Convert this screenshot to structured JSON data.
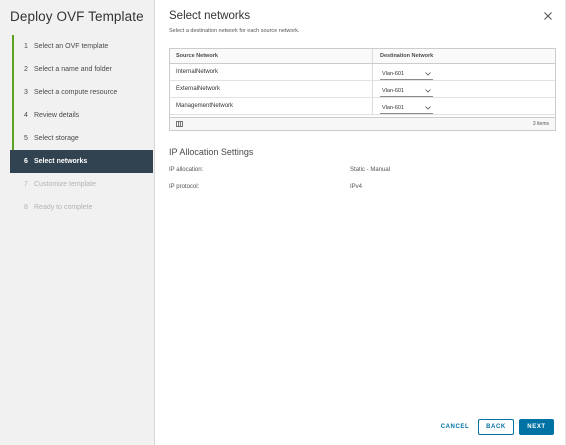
{
  "wizard": {
    "title": "Deploy OVF Template",
    "steps": [
      {
        "num": "1",
        "label": "Select an OVF template",
        "state": "done"
      },
      {
        "num": "2",
        "label": "Select a name and folder",
        "state": "done"
      },
      {
        "num": "3",
        "label": "Select a compute resource",
        "state": "done"
      },
      {
        "num": "4",
        "label": "Review details",
        "state": "done"
      },
      {
        "num": "5",
        "label": "Select storage",
        "state": "done"
      },
      {
        "num": "6",
        "label": "Select networks",
        "state": "active"
      },
      {
        "num": "7",
        "label": "Customize template",
        "state": "disabled"
      },
      {
        "num": "8",
        "label": "Ready to complete",
        "state": "disabled"
      }
    ]
  },
  "page": {
    "title": "Select networks",
    "subtitle": "Select a destination network for each source network."
  },
  "grid": {
    "headers": {
      "source": "Source Network",
      "destination": "Destination Network"
    },
    "rows": [
      {
        "source": "InternalNetwork",
        "destination": "Vlan-601"
      },
      {
        "source": "ExternalNetwork",
        "destination": "Vlan-601"
      },
      {
        "source": "ManagementNetwork",
        "destination": "Vlan-601"
      }
    ],
    "footer_count": "3 items"
  },
  "ip_settings": {
    "title": "IP Allocation Settings",
    "allocation_label": "IP allocation:",
    "allocation_value": "Static - Manual",
    "protocol_label": "IP protocol:",
    "protocol_value": "IPv4"
  },
  "buttons": {
    "cancel": "CANCEL",
    "back": "BACK",
    "next": "NEXT"
  },
  "colors": {
    "accent": "#0072a3",
    "completed_step": "#5aa220",
    "active_step_bg": "#314351"
  }
}
